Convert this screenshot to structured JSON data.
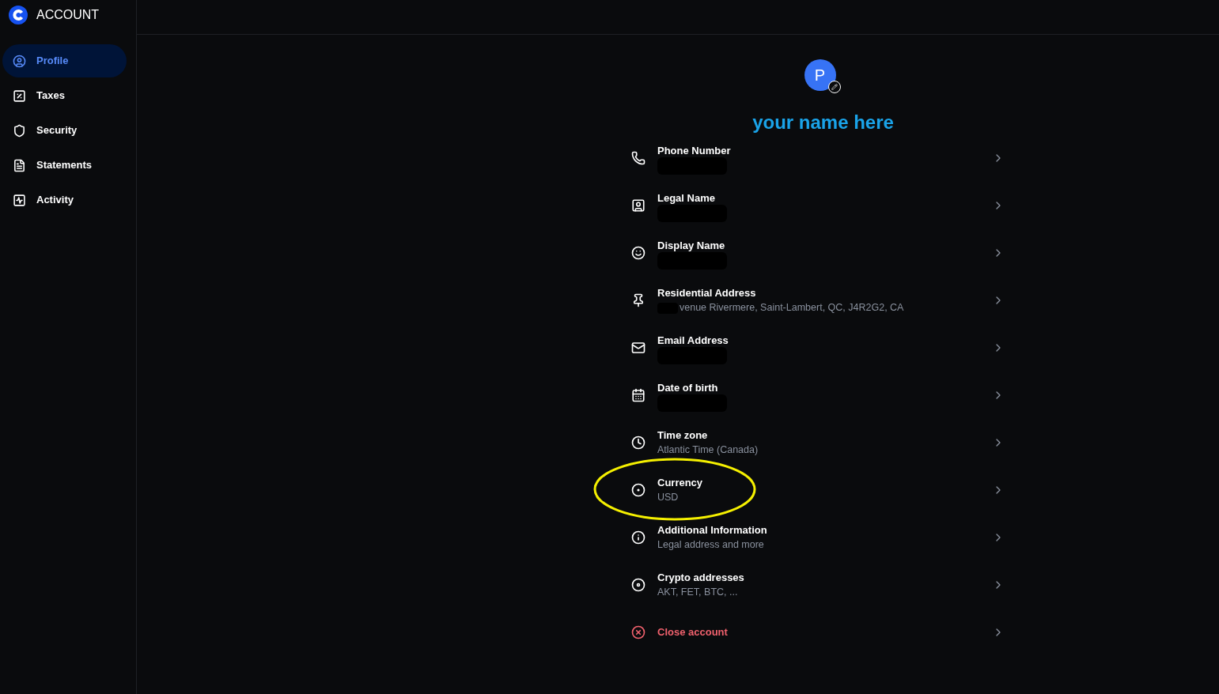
{
  "brand": {
    "title": "ACCOUNT"
  },
  "sidebar": {
    "items": [
      {
        "label": "Profile",
        "kind": "profile",
        "selected": true
      },
      {
        "label": "Taxes",
        "kind": "taxes",
        "selected": false
      },
      {
        "label": "Security",
        "kind": "security",
        "selected": false
      },
      {
        "label": "Statements",
        "kind": "statements",
        "selected": false
      },
      {
        "label": "Activity",
        "kind": "activity",
        "selected": false
      }
    ]
  },
  "profile": {
    "avatar_letter": "P",
    "name_annotation": "your name here",
    "rows": [
      {
        "kind": "phone",
        "title": "Phone Number",
        "redacted": true
      },
      {
        "kind": "legal",
        "title": "Legal Name",
        "redacted": true
      },
      {
        "kind": "display",
        "title": "Display Name",
        "redacted": true
      },
      {
        "kind": "address",
        "title": "Residential Address",
        "value": "venue Rivermere, Saint-Lambert, QC, J4R2G2, CA",
        "redacted": true
      },
      {
        "kind": "email",
        "title": "Email Address",
        "redacted": true
      },
      {
        "kind": "birth",
        "title": "Date of birth",
        "redacted": true
      },
      {
        "kind": "timezone",
        "title": "Time zone",
        "value": "Atlantic Time (Canada)"
      },
      {
        "kind": "currency",
        "title": "Currency",
        "value": "USD",
        "circled": true
      },
      {
        "kind": "info",
        "title": "Additional Information",
        "value": "Legal address and more"
      },
      {
        "kind": "crypto",
        "title": "Crypto addresses",
        "value": "AKT, FET, BTC, ..."
      },
      {
        "kind": "close",
        "title": "Close account",
        "danger": true
      }
    ]
  }
}
